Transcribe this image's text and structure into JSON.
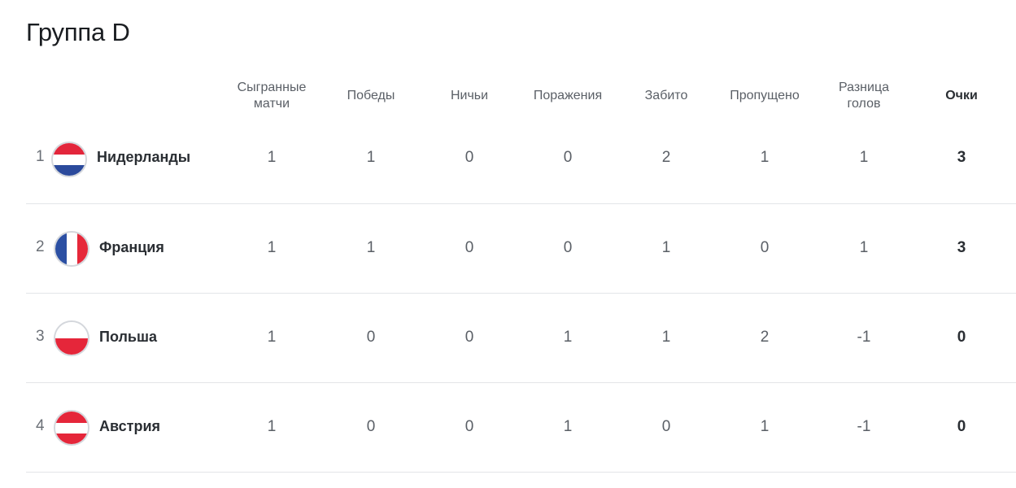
{
  "title": "Группа D",
  "columns": [
    {
      "key": "played",
      "label": "Сыгранные\nматчи"
    },
    {
      "key": "wins",
      "label": "Победы"
    },
    {
      "key": "draws",
      "label": "Ничьи"
    },
    {
      "key": "losses",
      "label": "Поражения"
    },
    {
      "key": "scored",
      "label": "Забито"
    },
    {
      "key": "conceded",
      "label": "Пропущено"
    },
    {
      "key": "diff",
      "label": "Разница\nголов"
    },
    {
      "key": "points",
      "label": "Очки"
    }
  ],
  "rows": [
    {
      "rank": "1",
      "team": "Нидерланды",
      "flag": "netherlands-flag-icon",
      "played": "1",
      "wins": "1",
      "draws": "0",
      "losses": "0",
      "scored": "2",
      "conceded": "1",
      "diff": "1",
      "points": "3"
    },
    {
      "rank": "2",
      "team": "Франция",
      "flag": "france-flag-icon",
      "played": "1",
      "wins": "1",
      "draws": "0",
      "losses": "0",
      "scored": "1",
      "conceded": "0",
      "diff": "1",
      "points": "3"
    },
    {
      "rank": "3",
      "team": "Польша",
      "flag": "poland-flag-icon",
      "played": "1",
      "wins": "0",
      "draws": "0",
      "losses": "1",
      "scored": "1",
      "conceded": "2",
      "diff": "-1",
      "points": "0"
    },
    {
      "rank": "4",
      "team": "Австрия",
      "flag": "austria-flag-icon",
      "played": "1",
      "wins": "0",
      "draws": "0",
      "losses": "1",
      "scored": "0",
      "conceded": "1",
      "diff": "-1",
      "points": "0"
    }
  ],
  "colors": {
    "nl_red": "#e3263b",
    "nl_white": "#ffffff",
    "nl_blue": "#2b4a9c",
    "fr_blue": "#2b4fa3",
    "fr_white": "#ffffff",
    "fr_red": "#e6283a",
    "pl_white": "#ffffff",
    "pl_red": "#e5263a",
    "at_red": "#e5263a",
    "at_white": "#ffffff"
  }
}
